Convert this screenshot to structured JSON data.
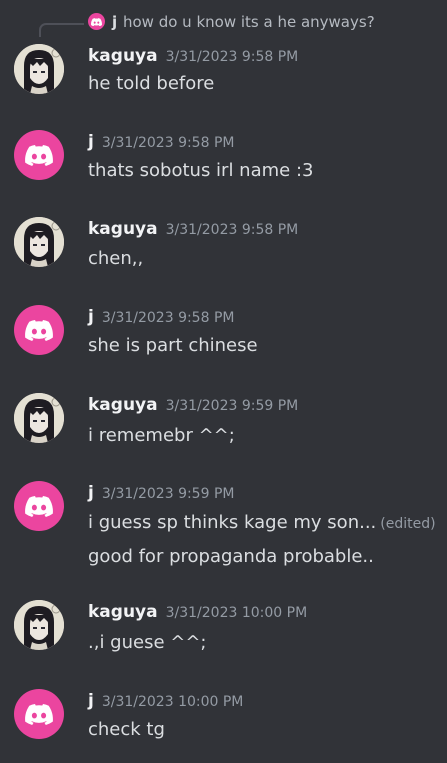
{
  "reply": {
    "author": "j",
    "text": "how do u know its a he anyways?"
  },
  "messages": [
    {
      "author": "kaguya",
      "timestamp": "3/31/2023 9:58 PM",
      "lines": [
        "he told before"
      ],
      "avatar": "anime-girl-avatar"
    },
    {
      "author": "j",
      "timestamp": "3/31/2023 9:58 PM",
      "lines": [
        "thats sobotus irl name :3"
      ],
      "avatar": "discord-default-avatar"
    },
    {
      "author": "kaguya",
      "timestamp": "3/31/2023 9:58 PM",
      "lines": [
        "chen,,"
      ],
      "avatar": "anime-girl-avatar"
    },
    {
      "author": "j",
      "timestamp": "3/31/2023 9:58 PM",
      "lines": [
        "she is part chinese"
      ],
      "avatar": "discord-default-avatar"
    },
    {
      "author": "kaguya",
      "timestamp": "3/31/2023 9:59 PM",
      "lines": [
        "i rememebr ^^;"
      ],
      "avatar": "anime-girl-avatar"
    },
    {
      "author": "j",
      "timestamp": "3/31/2023 9:59 PM",
      "lines": [
        "i guess sp thinks kage my son...",
        "good for propaganda probable.."
      ],
      "edited": "(edited)",
      "avatar": "discord-default-avatar"
    },
    {
      "author": "kaguya",
      "timestamp": "3/31/2023 10:00 PM",
      "lines": [
        ".,i guese ^^;"
      ],
      "avatar": "anime-girl-avatar"
    },
    {
      "author": "j",
      "timestamp": "3/31/2023 10:00 PM",
      "lines": [
        "check tg"
      ],
      "avatar": "discord-default-avatar"
    }
  ],
  "colors": {
    "background": "#313338",
    "discord_pink": "#eb459f",
    "text": "#dbdee1",
    "muted": "#949ba4"
  }
}
